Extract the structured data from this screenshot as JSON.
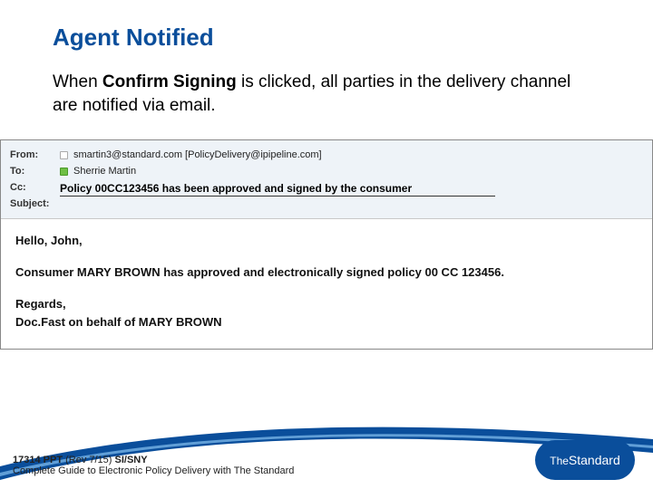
{
  "title": "Agent Notified",
  "desc": {
    "pre": "When ",
    "bold": "Confirm Signing",
    "post": " is clicked, all parties in the delivery channel are notified via email."
  },
  "email": {
    "labels": {
      "from": "From:",
      "to": "To:",
      "cc": "Cc:",
      "subject": "Subject:"
    },
    "from": "smartin3@standard.com [PolicyDelivery@ipipeline.com]",
    "to": "Sherrie Martin",
    "cc": "",
    "subject": "Policy 00CC123456 has been approved and signed by the consumer",
    "body": {
      "greet": "Hello, John,",
      "line1": "Consumer MARY BROWN has approved and electronically signed policy 00 CC 123456.",
      "closing1": "Regards,",
      "closing2": "Doc.Fast on behalf of  MARY BROWN"
    }
  },
  "footer": {
    "code1": "17314 PPT",
    "rev": " (Rev 7/15) ",
    "code2": "SI/SNY",
    "line2": "Complete Guide to Electronic Policy Delivery with The Standard"
  },
  "logo": {
    "the": "The",
    "brand": "Standard"
  }
}
